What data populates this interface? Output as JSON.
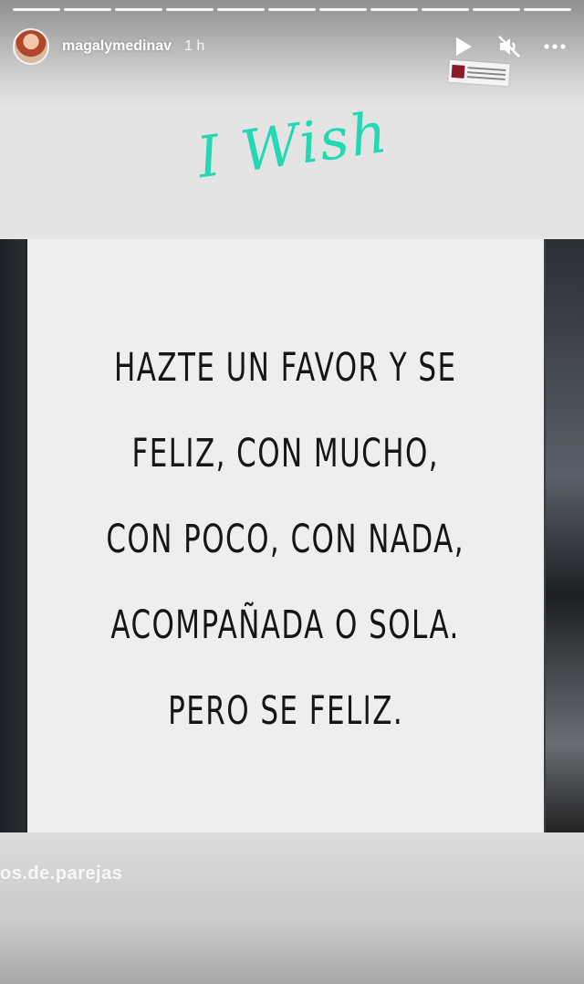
{
  "story": {
    "progress_segments": 11,
    "username": "magalymedinav",
    "timestamp": "1 h",
    "controls": [
      "play-icon",
      "muted-speaker-icon",
      "more-options-icon"
    ]
  },
  "sticker": {
    "headline": "I Wish",
    "color": "#24d8b4"
  },
  "poster": {
    "lines": [
      "HAZTE UN FAVOR Y SE",
      "FELIZ, CON MUCHO,",
      "CON POCO, CON NADA,",
      "ACOMPAÑADA O SOLA.",
      "PERO SE FELIZ."
    ]
  },
  "watermark": "os.de.parejas"
}
